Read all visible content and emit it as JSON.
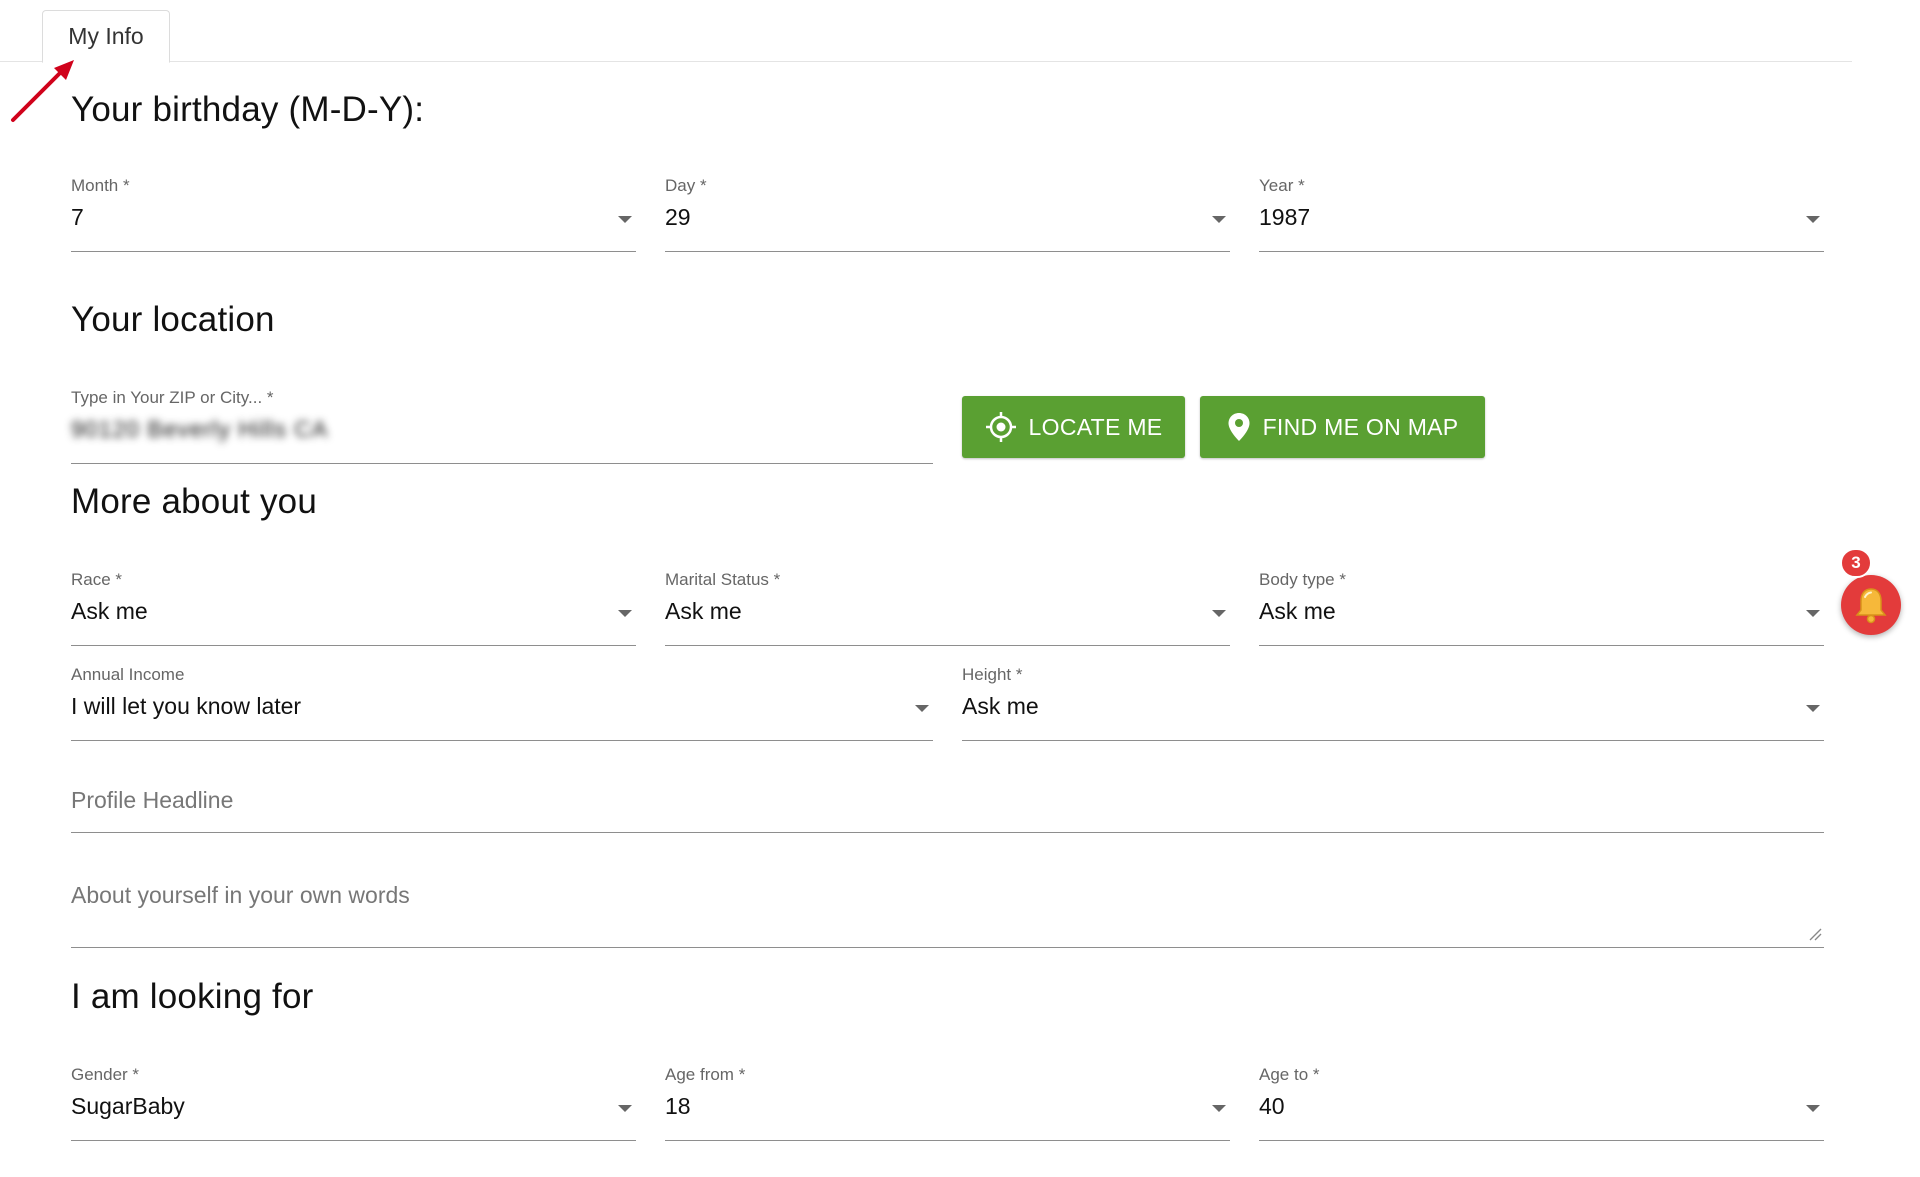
{
  "tabs": [
    {
      "label": "My Info",
      "active": true
    }
  ],
  "sections": {
    "birthday": "Your birthday (M-D-Y):",
    "location": "Your location",
    "more": "More about you",
    "looking": "I am looking for"
  },
  "birthday": {
    "month": {
      "label": "Month *",
      "value": "7"
    },
    "day": {
      "label": "Day *",
      "value": "29"
    },
    "year": {
      "label": "Year *",
      "value": "1987"
    }
  },
  "location": {
    "label": "Type in Your ZIP or City... *",
    "value": "90120 Beverly Hills CA",
    "locate_label": "LOCATE ME",
    "map_label": "FIND ME ON MAP"
  },
  "about": {
    "race": {
      "label": "Race *",
      "value": "Ask me"
    },
    "marital": {
      "label": "Marital Status *",
      "value": "Ask me"
    },
    "body": {
      "label": "Body type *",
      "value": "Ask me"
    },
    "income": {
      "label": "Annual Income",
      "value": "I will let you know later"
    },
    "height": {
      "label": "Height *",
      "value": "Ask me"
    },
    "headline_placeholder": "Profile Headline",
    "about_placeholder": "About yourself in your own words"
  },
  "looking": {
    "gender": {
      "label": "Gender *",
      "value": "SugarBaby"
    },
    "age_from": {
      "label": "Age from *",
      "value": "18"
    },
    "age_to": {
      "label": "Age to *",
      "value": "40"
    }
  },
  "notifications": {
    "count": "3",
    "icon": "bell-icon"
  },
  "colors": {
    "button": "#5aa032",
    "bell": "#e33b3b",
    "arrow": "#d0021b"
  }
}
